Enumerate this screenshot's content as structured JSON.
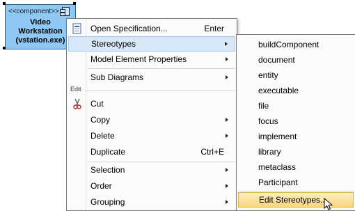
{
  "component": {
    "stereotype": "<<component>>",
    "name_line1": "Video",
    "name_line2": "Workstation",
    "name_line3": "(vstation.exe)",
    "fill_color": "#8ec8f3"
  },
  "context_menu": {
    "items": [
      {
        "label": "Open Specification...",
        "shortcut": "Enter",
        "icon": "open-spec-icon"
      },
      {
        "label": "Stereotypes",
        "submenu": true,
        "highlighted": true
      },
      {
        "label": "Model Element Properties",
        "submenu": true
      },
      {
        "label": "Sub Diagrams",
        "submenu": true
      }
    ],
    "edit_section_label": "Edit",
    "edit_items": [
      {
        "label": "Cut",
        "icon": "scissors-icon"
      },
      {
        "label": "Copy",
        "submenu": true
      },
      {
        "label": "Delete",
        "submenu": true
      },
      {
        "label": "Duplicate",
        "shortcut": "Ctrl+E"
      }
    ],
    "bottom_items": [
      {
        "label": "Selection",
        "submenu": true
      },
      {
        "label": "Order",
        "submenu": true
      },
      {
        "label": "Grouping",
        "submenu": true
      }
    ]
  },
  "stereotypes_submenu": {
    "items": [
      "buildComponent",
      "document",
      "entity",
      "executable",
      "file",
      "focus",
      "implement",
      "library",
      "metaclass",
      "Participant"
    ],
    "edit_label": "Edit Stereotypes..."
  },
  "colors": {
    "highlight": "#d9e8f8",
    "hover_highlight": "#f6d680"
  }
}
